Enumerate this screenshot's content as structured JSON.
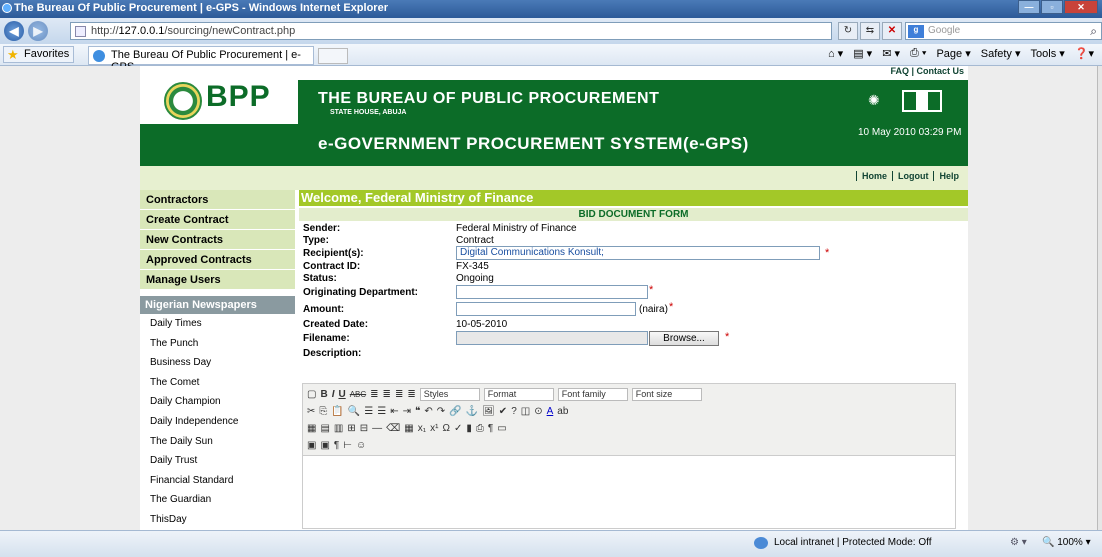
{
  "window": {
    "title": "The Bureau Of Public Procurement | e-GPS - Windows Internet Explorer"
  },
  "address": {
    "url_prefix": "http://",
    "url_host": "127.0.0.1",
    "url_path": "/sourcing/newContract.php",
    "search_placeholder": "Google"
  },
  "favorites": {
    "label": "Favorites",
    "tab_title": "The Bureau Of Public Procurement | e-GPS"
  },
  "commands": {
    "page": "Page ▾",
    "safety": "Safety ▾",
    "tools": "Tools ▾"
  },
  "header": {
    "faq_contact": "FAQ | Contact Us",
    "logo_text": "BPP",
    "org_name": "THE BUREAU OF PUBLIC PROCUREMENT",
    "org_sub": "STATE HOUSE, ABUJA",
    "system_name": "e-GOVERNMENT PROCUREMENT SYSTEM(e-GPS)",
    "datetime": "10 May 2010 03:29 PM"
  },
  "topnav": {
    "home": "Home",
    "logout": "Logout",
    "help": "Help"
  },
  "sidebar": {
    "items": [
      "Contractors",
      "Create Contract",
      "New Contracts",
      "Approved Contracts",
      "Manage Users"
    ],
    "papers_heading": "Nigerian Newspapers",
    "papers": [
      "Daily Times",
      "The Punch",
      "Business Day",
      "The Comet",
      "Daily Champion",
      "Daily Independence",
      "The Daily Sun",
      "Daily Trust",
      "Financial Standard",
      "The Guardian",
      "ThisDay"
    ]
  },
  "main": {
    "welcome": "Welcome, Federal Ministry of Finance",
    "form_title": "BID DOCUMENT FORM",
    "sender_label": "Sender:",
    "sender_value": "Federal Ministry of Finance",
    "type_label": "Type:",
    "type_value": "Contract",
    "recipients_label": "Recipient(s):",
    "recipients_value": "Digital Communications Konsult;",
    "contract_id_label": "Contract ID:",
    "contract_id_value": "FX-345",
    "status_label": "Status:",
    "status_value": "Ongoing",
    "dept_label": "Originating Department:",
    "dept_value": "",
    "amount_label": "Amount:",
    "amount_value": "",
    "amount_unit": "(naira)",
    "created_label": "Created Date:",
    "created_value": "10-05-2010",
    "filename_label": "Filename:",
    "browse_label": "Browse...",
    "description_label": "Description:"
  },
  "editor": {
    "styles": "Styles",
    "format": "Format",
    "font_family": "Font family",
    "font_size": "Font size"
  },
  "status": {
    "zone": "Local intranet | Protected Mode: Off",
    "zoom": "100%"
  }
}
